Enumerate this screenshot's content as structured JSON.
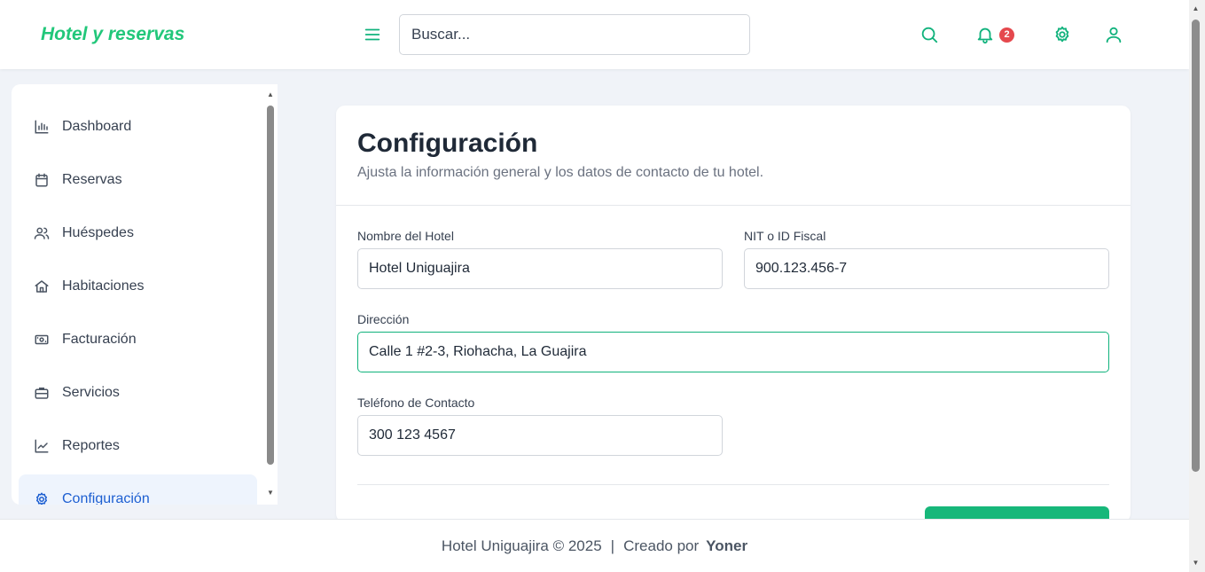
{
  "header": {
    "brand": "Hotel y reservas",
    "search_placeholder": "Buscar...",
    "notification_count": "2",
    "icons": [
      "menu-icon",
      "search-icon",
      "bell-icon",
      "gear-icon",
      "user-icon"
    ]
  },
  "sidebar": {
    "items": [
      {
        "label": "Dashboard",
        "icon": "bar-chart-icon"
      },
      {
        "label": "Reservas",
        "icon": "calendar-icon"
      },
      {
        "label": "Huéspedes",
        "icon": "users-icon"
      },
      {
        "label": "Habitaciones",
        "icon": "home-icon"
      },
      {
        "label": "Facturación",
        "icon": "cash-icon"
      },
      {
        "label": "Servicios",
        "icon": "briefcase-icon"
      },
      {
        "label": "Reportes",
        "icon": "trend-icon"
      },
      {
        "label": "Configuración",
        "icon": "gear-icon",
        "active": true
      }
    ]
  },
  "settings": {
    "title": "Configuración",
    "subtitle": "Ajusta la información general y los datos de contacto de tu hotel.",
    "fields": {
      "hotel_name": {
        "label": "Nombre del Hotel",
        "value": "Hotel Uniguajira"
      },
      "tax_id": {
        "label": "NIT o ID Fiscal",
        "value": "900.123.456-7"
      },
      "address": {
        "label": "Dirección",
        "value": "Calle 1 #2-3, Riohacha, La Guajira"
      },
      "phone": {
        "label": "Teléfono de Contacto",
        "value": "300 123 4567"
      }
    }
  },
  "footer": {
    "copyright": "Hotel Uniguajira © 2025",
    "separator": "|",
    "created_by": "Creado por",
    "author": "Yoner"
  },
  "colors": {
    "accent": "#10b27c",
    "brand": "#22c77a",
    "active_nav": "#1d5fd1",
    "badge": "#e5484d"
  }
}
